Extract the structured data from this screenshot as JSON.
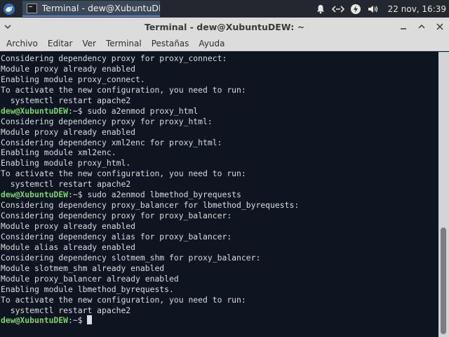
{
  "panel": {
    "menu_icon": "xubuntu-whisker-icon",
    "task_icon": "terminal-icon",
    "task_label": "Terminal - dew@XubuntuDE...",
    "tray_icons": [
      "bell-icon",
      "network-icon",
      "power-icon",
      "volume-icon"
    ],
    "clock": "22 nov, 16:39"
  },
  "window": {
    "title": "Terminal - dew@XubuntuDEW: ~",
    "buttons": [
      "minimize-icon",
      "maximize-icon",
      "close-icon"
    ]
  },
  "menubar": {
    "items": [
      "Archivo",
      "Editar",
      "Ver",
      "Terminal",
      "Pestañas",
      "Ayuda"
    ]
  },
  "terminal": {
    "prompt_user": "dew@XubuntuDEW",
    "prompt_rest": ":~$ ",
    "lines": [
      {
        "type": "out",
        "text": "Considering dependency proxy for proxy_connect:"
      },
      {
        "type": "out",
        "text": "Module proxy already enabled"
      },
      {
        "type": "out",
        "text": "Enabling module proxy_connect."
      },
      {
        "type": "out",
        "text": "To activate the new configuration, you need to run:"
      },
      {
        "type": "out",
        "text": "  systemctl restart apache2"
      },
      {
        "type": "cmd",
        "text": "sudo a2enmod proxy_html"
      },
      {
        "type": "out",
        "text": "Considering dependency proxy for proxy_html:"
      },
      {
        "type": "out",
        "text": "Module proxy already enabled"
      },
      {
        "type": "out",
        "text": "Considering dependency xml2enc for proxy_html:"
      },
      {
        "type": "out",
        "text": "Enabling module xml2enc."
      },
      {
        "type": "out",
        "text": "Enabling module proxy_html."
      },
      {
        "type": "out",
        "text": "To activate the new configuration, you need to run:"
      },
      {
        "type": "out",
        "text": "  systemctl restart apache2"
      },
      {
        "type": "cmd",
        "text": "sudo a2enmod lbmethod_byrequests"
      },
      {
        "type": "out",
        "text": "Considering dependency proxy_balancer for lbmethod_byrequests:"
      },
      {
        "type": "out",
        "text": "Considering dependency proxy for proxy_balancer:"
      },
      {
        "type": "out",
        "text": "Module proxy already enabled"
      },
      {
        "type": "out",
        "text": "Considering dependency alias for proxy_balancer:"
      },
      {
        "type": "out",
        "text": "Module alias already enabled"
      },
      {
        "type": "out",
        "text": "Considering dependency slotmem_shm for proxy_balancer:"
      },
      {
        "type": "out",
        "text": "Module slotmem_shm already enabled"
      },
      {
        "type": "out",
        "text": "Module proxy_balancer already enabled"
      },
      {
        "type": "out",
        "text": "Enabling module lbmethod_byrequests."
      },
      {
        "type": "out",
        "text": "To activate the new configuration, you need to run:"
      },
      {
        "type": "out",
        "text": "  systemctl restart apache2"
      },
      {
        "type": "cmd",
        "text": ""
      }
    ]
  }
}
